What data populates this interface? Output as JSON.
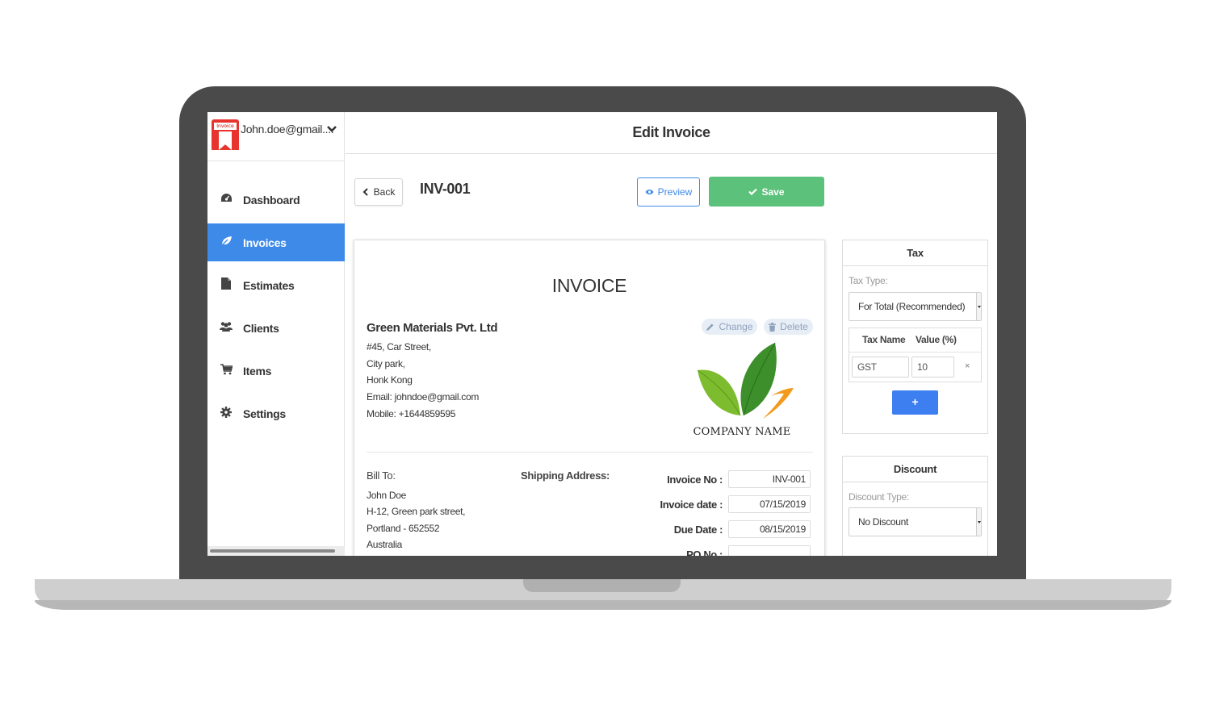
{
  "colors": {
    "accent": "#3d8ae8",
    "save_green": "#5cc17b",
    "add_blue": "#3d7ef0",
    "frame": "#4a4a4a"
  },
  "sidebar": {
    "user_email": "John.doe@gmail....",
    "logo_label": "Invoice",
    "items": [
      {
        "label": "Dashboard",
        "icon": "dashboard-icon",
        "active": false
      },
      {
        "label": "Invoices",
        "icon": "leaf-icon",
        "active": true
      },
      {
        "label": "Estimates",
        "icon": "file-icon",
        "active": false
      },
      {
        "label": "Clients",
        "icon": "users-icon",
        "active": false
      },
      {
        "label": "Items",
        "icon": "cart-icon",
        "active": false
      },
      {
        "label": "Settings",
        "icon": "gear-icon",
        "active": false
      }
    ]
  },
  "header": {
    "title": "Edit Invoice"
  },
  "toolbar": {
    "back_label": "Back",
    "invoice_number": "INV-001",
    "preview_label": "Preview",
    "save_label": "Save"
  },
  "invoice": {
    "heading": "INVOICE",
    "company": {
      "name": "Green Materials Pvt. Ltd",
      "address_lines": [
        "#45, Car Street,",
        "City park,",
        "Honk Kong"
      ],
      "email": "Email: johndoe@gmail.com",
      "mobile": "Mobile: +1644859595"
    },
    "logo_actions": {
      "change_label": "Change",
      "delete_label": "Delete"
    },
    "logo_text": "COMPANY NAME",
    "bill_to": {
      "label": "Bill To:",
      "lines": [
        "John Doe",
        "H-12, Green park street,",
        "Portland - 652552",
        "Australia"
      ]
    },
    "shipping": {
      "label": "Shipping Address:"
    },
    "meta": [
      {
        "label": "Invoice No :",
        "value": "INV-001"
      },
      {
        "label": "Invoice date :",
        "value": "07/15/2019"
      },
      {
        "label": "Due Date :",
        "value": "08/15/2019"
      },
      {
        "label": "PO No :",
        "value": ""
      }
    ]
  },
  "tax_panel": {
    "title": "Tax",
    "type_label": "Tax Type:",
    "type_value": "For Total (Recommended)",
    "col_name": "Tax Name",
    "col_value": "Value (%)",
    "row": {
      "name": "GST",
      "value": "10"
    },
    "delete_symbol": "×",
    "add_symbol": "+"
  },
  "discount_panel": {
    "title": "Discount",
    "type_label": "Discount Type:",
    "type_value": "No Discount"
  }
}
